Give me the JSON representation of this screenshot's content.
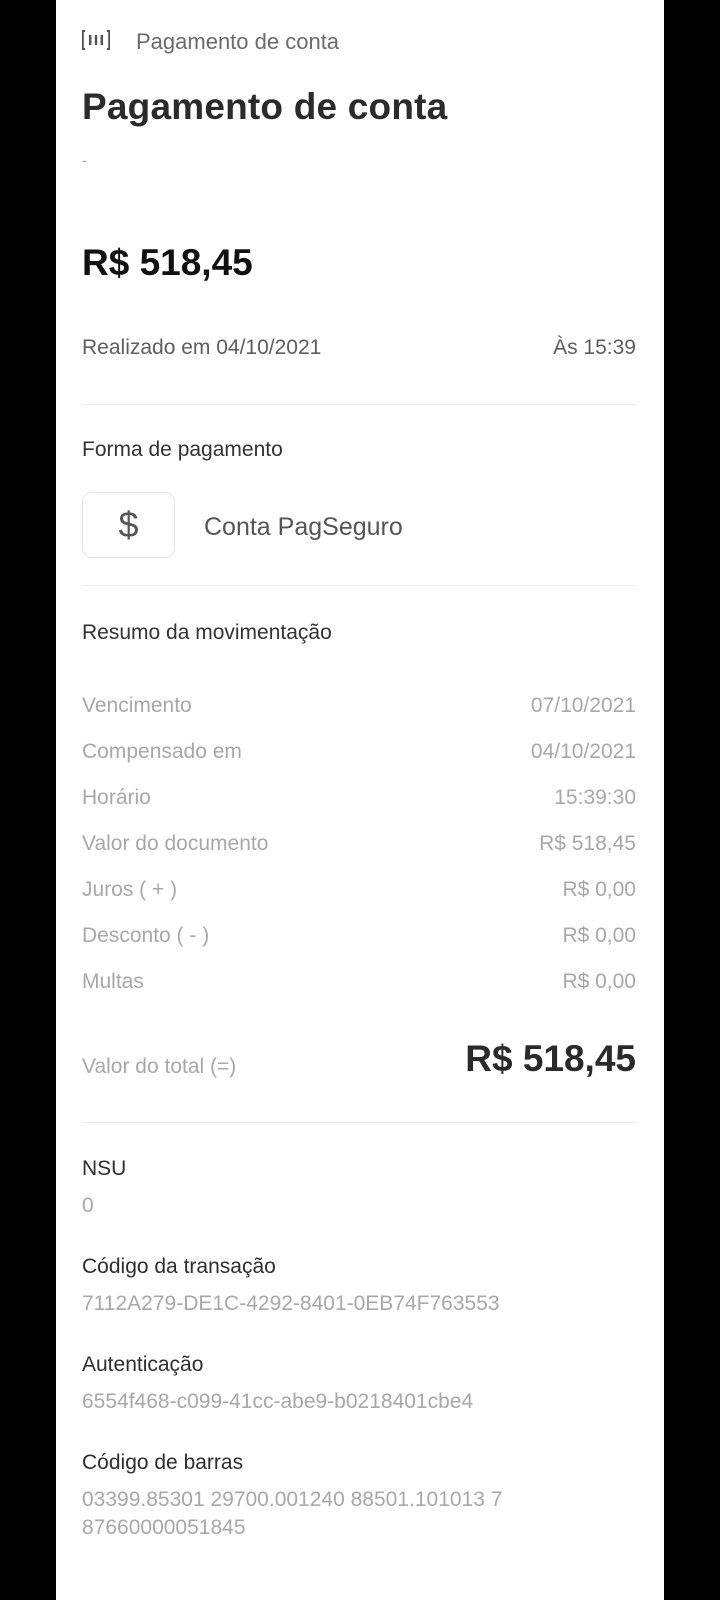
{
  "header": {
    "icon": "barcode-icon",
    "title": "Pagamento de conta"
  },
  "page_title": "Pagamento de conta",
  "subtitle": "-",
  "amount": "R$ 518,45",
  "realizado": "Realizado em 04/10/2021",
  "hora": "Às 15:39",
  "forma_pagamento": {
    "label": "Forma de pagamento",
    "icon": "dollar-icon",
    "icon_glyph": "$",
    "method": "Conta PagSeguro"
  },
  "resumo": {
    "label": "Resumo da movimentação",
    "rows": [
      {
        "label": "Vencimento",
        "value": "07/10/2021"
      },
      {
        "label": "Compensado em",
        "value": "04/10/2021"
      },
      {
        "label": "Horário",
        "value": "15:39:30"
      },
      {
        "label": "Valor do documento",
        "value": "R$ 518,45"
      },
      {
        "label": "Juros ( + )",
        "value": "R$ 0,00"
      },
      {
        "label": "Desconto ( - )",
        "value": "R$ 0,00"
      },
      {
        "label": "Multas",
        "value": "R$ 0,00"
      }
    ],
    "total_label": "Valor do total (=)",
    "total_value": "R$ 518,45"
  },
  "details": {
    "nsu_label": "NSU",
    "nsu_value": "0",
    "codigo_label": "Código da transação",
    "codigo_value": "7112A279-DE1C-4292-8401-0EB74F763553",
    "autenticacao_label": "Autenticação",
    "autenticacao_value": "6554f468-c099-41cc-abe9-b0218401cbe4",
    "barras_label": "Código de barras",
    "barras_value": "03399.85301 29700.001240 88501.101013 7 87660000051845"
  },
  "colors": {
    "background": "#000000",
    "sheet": "#ffffff",
    "muted_text": "#a8a8a8"
  }
}
